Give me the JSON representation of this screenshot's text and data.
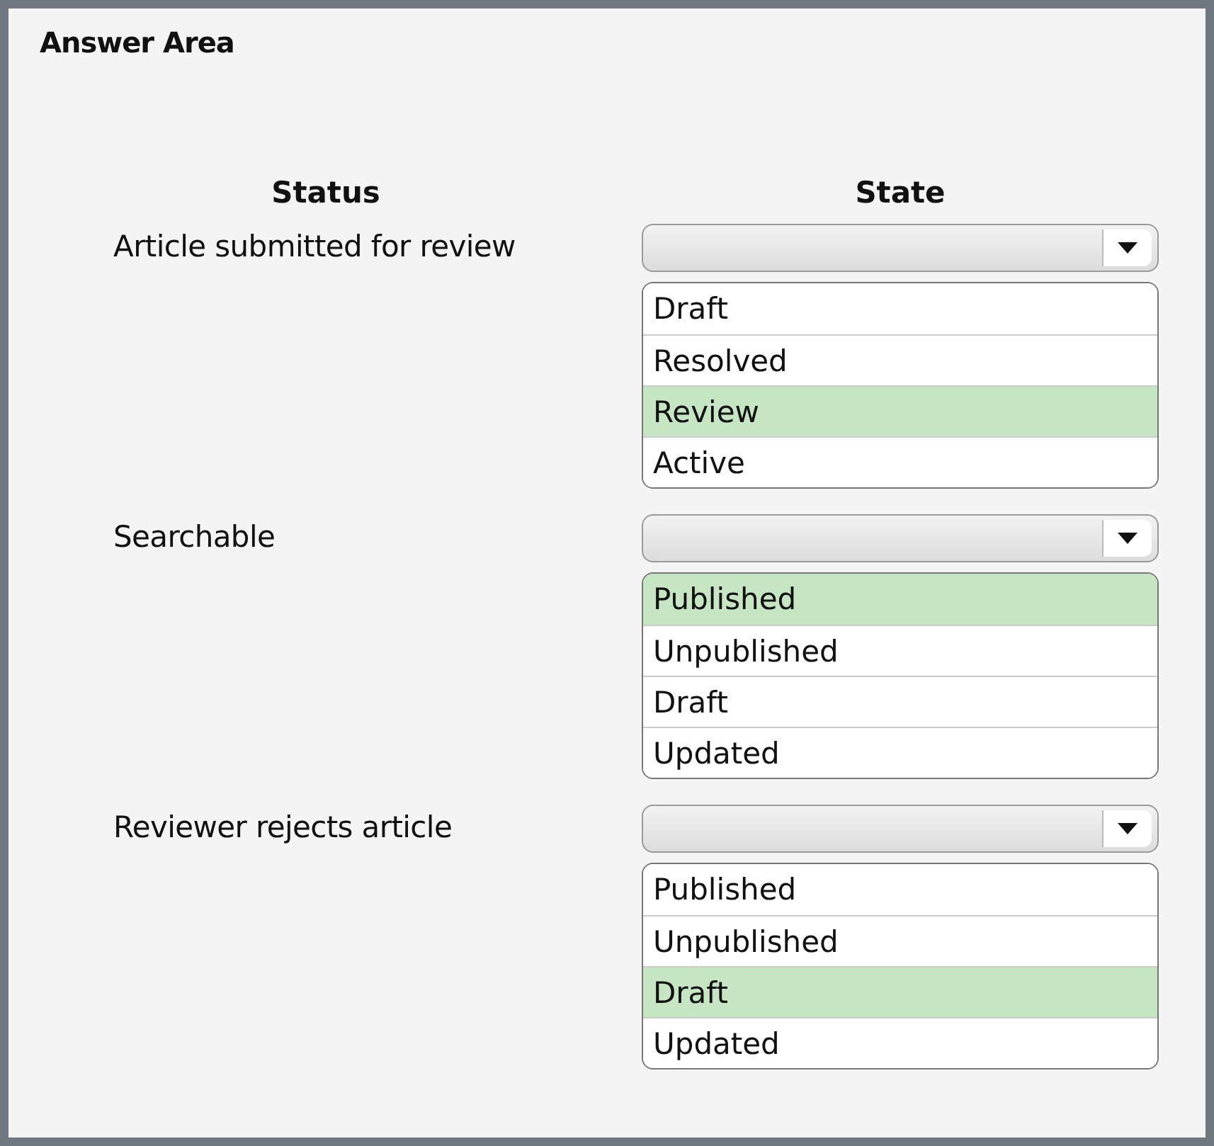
{
  "title": "Answer Area",
  "headers": [
    "Status",
    "State"
  ],
  "rows": [
    {
      "status": "Article submitted for review",
      "options": [
        {
          "label": "Draft",
          "selected": false
        },
        {
          "label": "Resolved",
          "selected": false
        },
        {
          "label": "Review",
          "selected": true
        },
        {
          "label": "Active",
          "selected": false
        }
      ]
    },
    {
      "status": "Searchable",
      "options": [
        {
          "label": "Published",
          "selected": true
        },
        {
          "label": "Unpublished",
          "selected": false
        },
        {
          "label": "Draft",
          "selected": false
        },
        {
          "label": "Updated",
          "selected": false
        }
      ]
    },
    {
      "status": "Reviewer rejects article",
      "options": [
        {
          "label": "Published",
          "selected": false
        },
        {
          "label": "Unpublished",
          "selected": false
        },
        {
          "label": "Draft",
          "selected": true
        },
        {
          "label": "Updated",
          "selected": false
        }
      ]
    }
  ]
}
